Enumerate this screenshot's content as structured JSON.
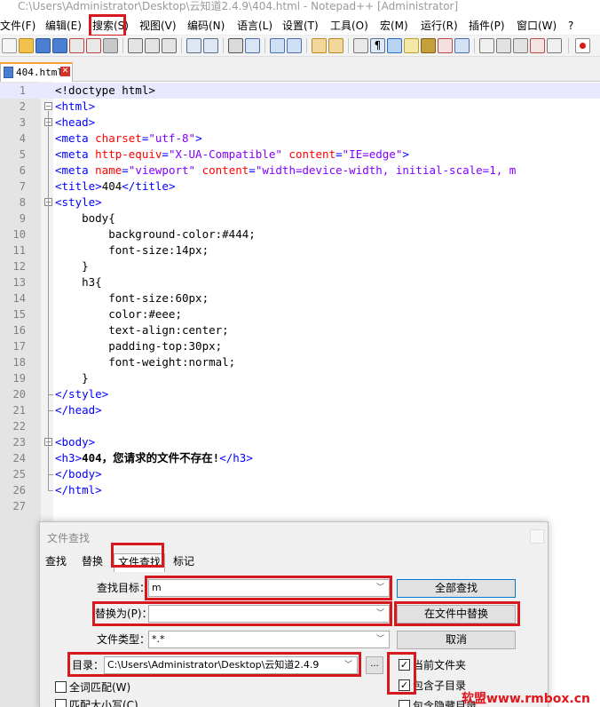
{
  "window": {
    "title": "C:\\Users\\Administrator\\Desktop\\云知道2.4.9\\404.html - Notepad++ [Administrator]"
  },
  "menu": {
    "items": [
      "文件(F)",
      "编辑(E)",
      "搜索(S)",
      "视图(V)",
      "编码(N)",
      "语言(L)",
      "设置(T)",
      "工具(O)",
      "宏(M)",
      "运行(R)",
      "插件(P)",
      "窗口(W)",
      "?"
    ],
    "highlighted": "搜索(S)"
  },
  "tabs": {
    "active_file": "404.html"
  },
  "editor": {
    "current_line": 1,
    "lines": [
      {
        "n": "1",
        "segs": [
          [
            "txt",
            "<!doctype html>"
          ]
        ]
      },
      {
        "n": "2",
        "segs": [
          [
            "tag",
            "<html>"
          ]
        ]
      },
      {
        "n": "3",
        "segs": [
          [
            "tag",
            "<head>"
          ]
        ]
      },
      {
        "n": "4",
        "segs": [
          [
            "tag",
            "<meta "
          ],
          [
            "attr",
            "charset"
          ],
          [
            "tag",
            "="
          ],
          [
            "val",
            "\"utf-8\""
          ],
          [
            "tag",
            ">"
          ]
        ]
      },
      {
        "n": "5",
        "segs": [
          [
            "tag",
            "<meta "
          ],
          [
            "attr",
            "http-equiv"
          ],
          [
            "tag",
            "="
          ],
          [
            "val",
            "\"X-UA-Compatible\""
          ],
          [
            "tag",
            " "
          ],
          [
            "attr",
            "content"
          ],
          [
            "tag",
            "="
          ],
          [
            "val",
            "\"IE=edge\""
          ],
          [
            "tag",
            ">"
          ]
        ]
      },
      {
        "n": "6",
        "segs": [
          [
            "tag",
            "<meta "
          ],
          [
            "attr",
            "name"
          ],
          [
            "tag",
            "="
          ],
          [
            "val",
            "\"viewport\""
          ],
          [
            "tag",
            " "
          ],
          [
            "attr",
            "content"
          ],
          [
            "tag",
            "="
          ],
          [
            "val",
            "\"width=device-width, initial-scale=1, m"
          ]
        ]
      },
      {
        "n": "7",
        "segs": [
          [
            "tag",
            "<title>"
          ],
          [
            "txt",
            "404"
          ],
          [
            "tag",
            "</title>"
          ]
        ]
      },
      {
        "n": "8",
        "segs": [
          [
            "tag",
            "<style>"
          ]
        ]
      },
      {
        "n": "9",
        "segs": [
          [
            "txt",
            "    body{"
          ]
        ]
      },
      {
        "n": "10",
        "segs": [
          [
            "txt",
            "        background-color:#444;"
          ]
        ]
      },
      {
        "n": "11",
        "segs": [
          [
            "txt",
            "        font-size:14px;"
          ]
        ]
      },
      {
        "n": "12",
        "segs": [
          [
            "txt",
            "    }"
          ]
        ]
      },
      {
        "n": "13",
        "segs": [
          [
            "txt",
            "    h3{"
          ]
        ]
      },
      {
        "n": "14",
        "segs": [
          [
            "txt",
            "        font-size:60px;"
          ]
        ]
      },
      {
        "n": "15",
        "segs": [
          [
            "txt",
            "        color:#eee;"
          ]
        ]
      },
      {
        "n": "16",
        "segs": [
          [
            "txt",
            "        text-align:center;"
          ]
        ]
      },
      {
        "n": "17",
        "segs": [
          [
            "txt",
            "        padding-top:30px;"
          ]
        ]
      },
      {
        "n": "18",
        "segs": [
          [
            "txt",
            "        font-weight:normal;"
          ]
        ]
      },
      {
        "n": "19",
        "segs": [
          [
            "txt",
            "    }"
          ]
        ]
      },
      {
        "n": "20",
        "segs": [
          [
            "tag",
            "</style>"
          ]
        ]
      },
      {
        "n": "21",
        "segs": [
          [
            "tag",
            "</head>"
          ]
        ]
      },
      {
        "n": "22",
        "segs": []
      },
      {
        "n": "23",
        "segs": [
          [
            "tag",
            "<body>"
          ]
        ]
      },
      {
        "n": "24",
        "segs": [
          [
            "tag",
            "<h3>"
          ],
          [
            "bold",
            "404，您请求的文件不存在!"
          ],
          [
            "tag",
            "</h3>"
          ]
        ]
      },
      {
        "n": "25",
        "segs": [
          [
            "tag",
            "</body>"
          ]
        ]
      },
      {
        "n": "26",
        "segs": [
          [
            "tag",
            "</html>"
          ]
        ]
      },
      {
        "n": "27",
        "segs": []
      }
    ]
  },
  "dialog": {
    "title": "文件查找",
    "tabs": [
      "查找",
      "替换",
      "文件查找",
      "标记"
    ],
    "active_tab": "文件查找",
    "find_label": "查找目标：",
    "find_value": "m",
    "replace_label": "替换为(P)：",
    "replace_value": "",
    "filter_label": "文件类型：",
    "filter_value": "*.*",
    "dir_label": "目录：",
    "dir_value": "C:\\Users\\Administrator\\Desktop\\云知道2.4.9",
    "browse_label": "...",
    "find_all_button": "全部查找",
    "replace_in_files_button": "在文件中替换",
    "cancel_button": "取消",
    "opt_current_folder": "当前文件夹",
    "opt_current_folder_checked": true,
    "opt_subfolders": "包含子目录",
    "opt_subfolders_checked": true,
    "opt_hidden": "包含隐藏目录",
    "opt_whole_word": "全词匹配(W)",
    "opt_match_case": "匹配大小写(C)"
  },
  "watermark": "软盟www.rmbox.cn",
  "colors": {
    "highlight_box": "#d7191f",
    "tag": "#0000ff",
    "attribute": "#ff0000",
    "value": "#8000ff"
  }
}
